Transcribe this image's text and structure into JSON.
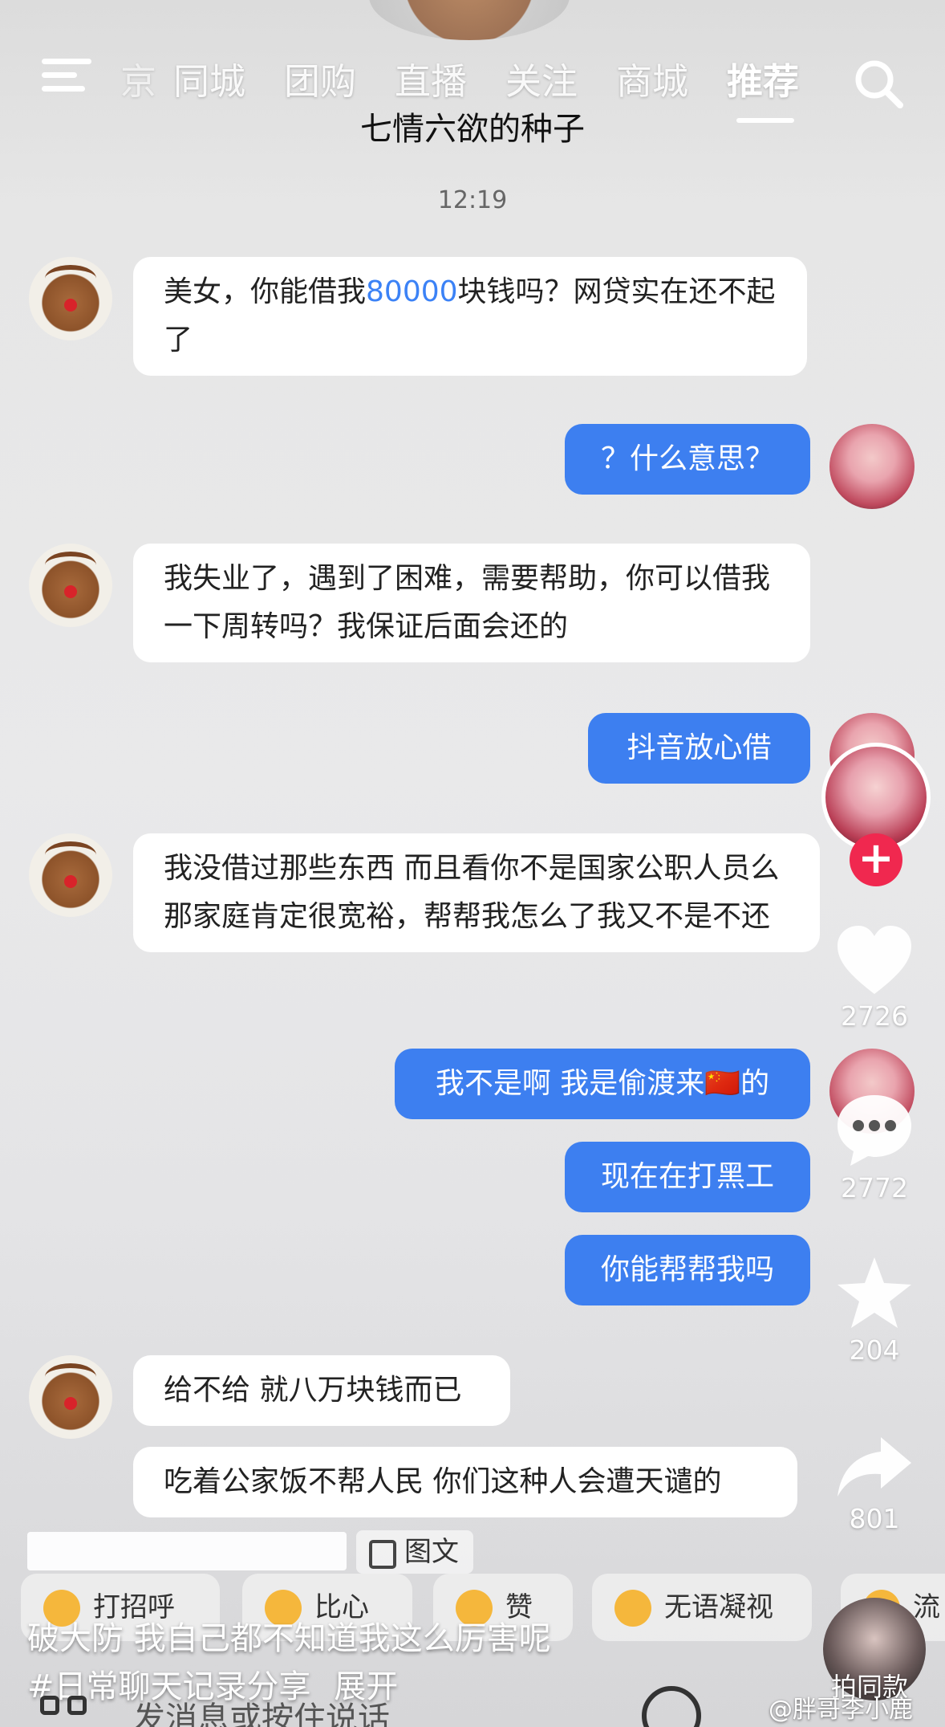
{
  "nav": {
    "tabs": [
      "京",
      "同城",
      "团购",
      "直播",
      "关注",
      "商城",
      "推荐"
    ],
    "active_tab": "推荐"
  },
  "chat": {
    "title": "七情六欲的种子",
    "timestamp": "12:19",
    "messages": [
      {
        "side": "left",
        "text_before": "美女，你能借我",
        "highlight": "80000",
        "text_after": "块钱吗？网贷实在还不起了"
      },
      {
        "side": "right",
        "text": "？什么意思？"
      },
      {
        "side": "left",
        "text": "我失业了，遇到了困难，需要帮助，你可以借我一下周转吗？我保证后面会还的"
      },
      {
        "side": "right",
        "text": "抖音放心借"
      },
      {
        "side": "left",
        "text": "我没借过那些东西 而且看你不是国家公职人员么 那家庭肯定很宽裕，帮帮我怎么了我又不是不还"
      },
      {
        "side": "right",
        "text": "我不是啊 我是偷渡来🇨🇳的"
      },
      {
        "side": "right",
        "text": "现在在打黑工"
      },
      {
        "side": "right",
        "text": "你能帮帮我吗"
      },
      {
        "side": "left",
        "text": "给不给 就八万块钱而已"
      },
      {
        "side": "left",
        "text": "吃着公家饭不帮人民 你们这种人会遭天谴的"
      }
    ]
  },
  "rail": {
    "likes": "2726",
    "comments": "2772",
    "favorites": "204",
    "shares": "801",
    "follow_label": "+"
  },
  "bottom": {
    "badge": "图文",
    "chips": [
      "打招呼",
      "比心",
      "赞",
      "无语凝视",
      "流"
    ],
    "caption_line1": "破大防 我自己都不知道我这么厉害呢",
    "caption_line2": "#日常聊天记录分享",
    "expand": "展开",
    "input_placeholder": "发消息或按住说话",
    "paiton": "拍同款",
    "watermark": "@胖哥李小鹿"
  }
}
